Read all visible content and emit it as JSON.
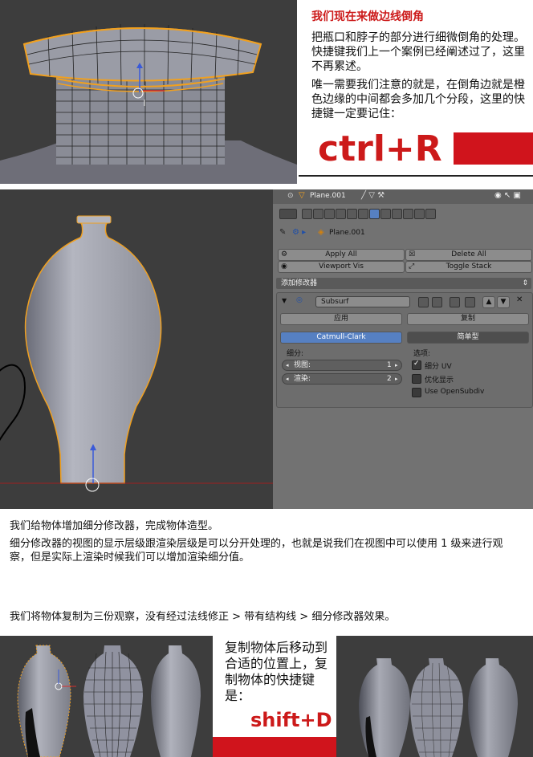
{
  "tip": {
    "title": "我们现在来做边线倒角",
    "p1": "把瓶口和脖子的部分进行细微倒角的处理。快捷键我们上一个案例已经阐述过了，这里不再累述。",
    "p2": "唯一需要我们注意的就是，在倒角边就是橙色边缘的中间都会多加几个分段，这里的快捷键一定要记住：",
    "shortcut": "ctrl+R"
  },
  "panel": {
    "header_object": "Plane.001",
    "breadcrumb_object": "Plane.001",
    "apply_all": "Apply All",
    "delete_all": "Delete All",
    "viewport_vis": "Viewport Vis",
    "toggle_stack": "Toggle Stack",
    "add_modifier": "添加修改器",
    "modifier_name": "Subsurf",
    "apply": "应用",
    "copy": "复制",
    "tab_catmull": "Catmull-Clark",
    "tab_simple": "简单型",
    "subdiv_label": "细分:",
    "options_label": "选项:",
    "view_label": "视图:",
    "view_value": "1",
    "render_label": "渲染:",
    "render_value": "2",
    "opt_uv": "细分 UV",
    "opt_display": "优化显示",
    "opt_opensubdiv": "Use OpenSubdiv"
  },
  "body": {
    "line1": "我们给物体增加细分修改器，完成物体造型。",
    "line2": "细分修改器的视图的显示层级跟渲染层级是可以分开处理的，也就是说我们在视图中可以使用 1 级来进行观察，但是实际上渲染时候我们可以增加渲染细分值。",
    "line3": "我们将物体复制为三份观察，没有经过法线修正 > 带有结构线 > 细分修改器效果。"
  },
  "copy_tip": {
    "text": "复制物体后移动到合适的位置上，复制物体的快捷键是：",
    "shortcut": "shift+D"
  },
  "colors": {
    "accent": "#d0141c",
    "viewport_bg": "#3d3d3d",
    "panel_bg": "#727272",
    "selected_tab": "#5680c2"
  }
}
